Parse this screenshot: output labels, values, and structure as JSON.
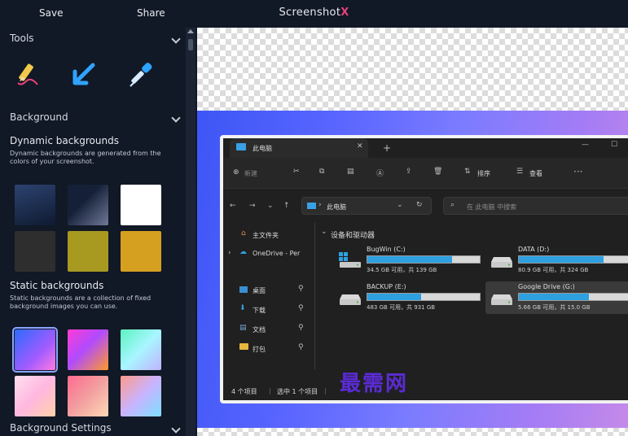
{
  "topbar": {
    "save": "Save",
    "share": "Share",
    "title_main": "Screenshot",
    "title_accent": "X"
  },
  "tools": {
    "label": "Tools",
    "items": [
      "pencil-tool",
      "arrow-tool",
      "pipette-tool"
    ]
  },
  "background": {
    "label": "Background",
    "dynamic": {
      "title": "Dynamic backgrounds",
      "desc": "Dynamic backgrounds are generated from the colors of your screenshot.",
      "swatches": [
        "#1b2a45",
        "#2a3450",
        "#ffffff",
        "#2e2e2e",
        "#a89a20",
        "#d5a020"
      ]
    },
    "static": {
      "title": "Static backgrounds",
      "desc": "Static backgrounds are a collection of fixed background images you can use.",
      "swatches": [
        "static-1",
        "static-2",
        "static-3",
        "static-4",
        "static-5",
        "static-6"
      ],
      "selected_index": 0
    },
    "settings_label": "Background Settings"
  },
  "explorer": {
    "tab_title": "此电脑",
    "new_label": "新建",
    "sort_label": "排序",
    "view_label": "查看",
    "address": "此电脑",
    "search_placeholder": "在 此电脑 中搜索",
    "nav": [
      "主文件夹",
      "OneDrive - Per",
      "桌面",
      "下载",
      "文档",
      "打包"
    ],
    "section_title": "设备和驱动器",
    "drives": [
      {
        "name": "BugWin (C:)",
        "info": "34.5 GB 可用，共 139 GB",
        "used": 0.75
      },
      {
        "name": "DATA (D:)",
        "info": "80.9 GB 可用，共 324 GB",
        "used": 0.75
      },
      {
        "name": "BACKUP (E:)",
        "info": "483 GB 可用，共 931 GB",
        "used": 0.48
      },
      {
        "name": "Google Drive (G:)",
        "info": "5.66 GB 可用，共 15.0 GB",
        "used": 0.62
      }
    ],
    "status_items": "4 个项目",
    "status_selected": "选中 1 个项目"
  },
  "watermark": "最需网"
}
